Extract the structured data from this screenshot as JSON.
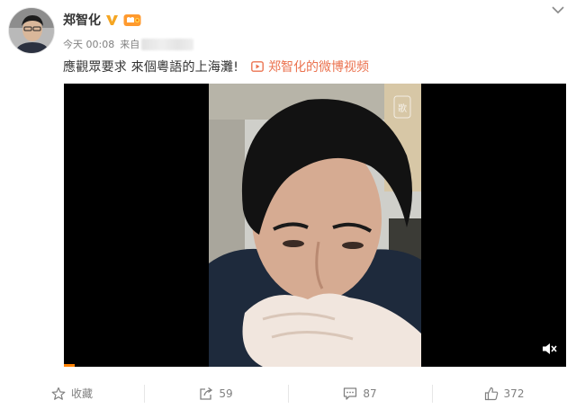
{
  "post": {
    "author": {
      "name": "郑智化",
      "avatar_icon": "user-avatar",
      "verified_icon": "verified-v-icon",
      "vip_icon": "vip-member-icon",
      "verified_color": "#f5a623"
    },
    "more_icon": "chevron-down-icon",
    "meta": {
      "time": "今天 00:08",
      "source_prefix": "来自"
    },
    "text": "應觀眾要求 來個粵語的上海灘!",
    "video_link": {
      "icon": "video-icon",
      "label": "郑智化的微博视频",
      "color": "#eb7350"
    },
    "video": {
      "watermark_icon": "watermark-icon",
      "mute_icon": "mute-icon",
      "progress_color": "#ff8200"
    },
    "actions": [
      {
        "icon": "star-icon",
        "label": "收藏"
      },
      {
        "icon": "share-icon",
        "label": "59"
      },
      {
        "icon": "comment-icon",
        "label": "87"
      },
      {
        "icon": "thumbs-up-icon",
        "label": "372"
      }
    ]
  }
}
